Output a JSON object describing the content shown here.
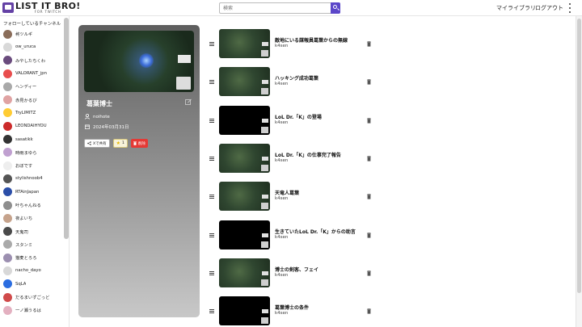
{
  "header": {
    "logo_title": "LIST IT BRO!",
    "logo_sub": "FOR TWITCH",
    "search_placeholder": "検索",
    "my_library": "マイライブラリ",
    "logout": "ログアウト"
  },
  "sidebar": {
    "heading": "フォローしているチャンネル",
    "channels": [
      {
        "name": "柊ツルギ",
        "color": "#8a6d5a"
      },
      {
        "name": "ow_uruca",
        "color": "#d9d9d9"
      },
      {
        "name": "みやしたちくわ",
        "color": "#6a4b7d"
      },
      {
        "name": "VALORANT_jpn",
        "color": "#e84d4d"
      },
      {
        "name": "ヘンディー",
        "color": "#a9a9a9"
      },
      {
        "name": "赤見かるび",
        "color": "#e0a3a3"
      },
      {
        "name": "TryLIMITZ",
        "color": "#ffcc33"
      },
      {
        "name": "LEONDAIHYOU",
        "color": "#cc2b2b"
      },
      {
        "name": "sasatikk",
        "color": "#333333"
      },
      {
        "name": "時雨まゆら",
        "color": "#c0a0d0"
      },
      {
        "name": "おぼです",
        "color": "#eeeeee"
      },
      {
        "name": "stylishnoob4",
        "color": "#555555"
      },
      {
        "name": "RTAinJapan",
        "color": "#2b4ea8"
      },
      {
        "name": "叶ちゃんねる",
        "color": "#8e8e8e"
      },
      {
        "name": "夜よいち",
        "color": "#c6a38c"
      },
      {
        "name": "天鬼司",
        "color": "#4a4a4a"
      },
      {
        "name": "スタンミ",
        "color": "#aaaaaa"
      },
      {
        "name": "猫麦とろろ",
        "color": "#9c8fb0"
      },
      {
        "name": "nacho_dayo",
        "color": "#d8d8d8"
      },
      {
        "name": "SqLA",
        "color": "#2b6de0"
      },
      {
        "name": "だるまいずごっど",
        "color": "#d04a4a"
      },
      {
        "name": "一ノ瀬うるは",
        "color": "#e3b0c0"
      }
    ]
  },
  "playlist": {
    "title": "葛葉博士",
    "owner": "noihote",
    "date": "2024年03月31日",
    "share_label": "Xで共有",
    "star_count": "1",
    "delete_label": "削除"
  },
  "videos": [
    {
      "title": "敵地にいる謀報員葛葉からの無線",
      "channel": "k4sen",
      "thumb": "game"
    },
    {
      "title": "ハッキング成功葛葉",
      "channel": "k4sen",
      "thumb": "game"
    },
    {
      "title": "LoL Dr.「K」の登場",
      "channel": "k4sen",
      "thumb": "dark"
    },
    {
      "title": "LoL Dr.「K」の仕事完了報告",
      "channel": "k4sen",
      "thumb": "game"
    },
    {
      "title": "天竜人葛葉",
      "channel": "k4sen",
      "thumb": "game"
    },
    {
      "title": "生きていたLoL Dr.「K」からの助言",
      "channel": "k4sen",
      "thumb": "dark"
    },
    {
      "title": "博士の剣客、フェイ",
      "channel": "k4sen",
      "thumb": "game"
    },
    {
      "title": "葛葉博士の条件",
      "channel": "k4sen",
      "thumb": "dark"
    }
  ]
}
